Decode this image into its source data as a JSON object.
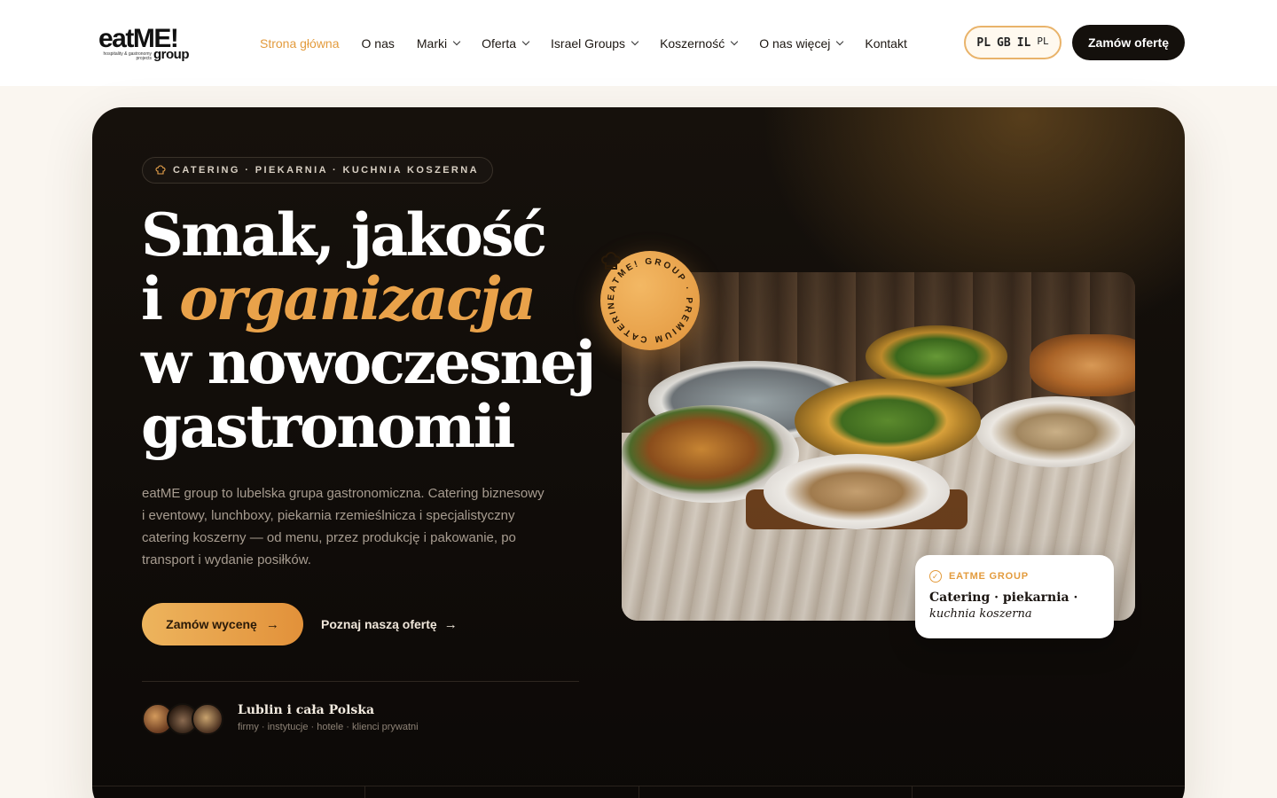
{
  "brand": {
    "name": "eatME!",
    "sub": "group",
    "tagline": "hospitality & gastronomy projects"
  },
  "nav": {
    "items": [
      {
        "label": "Strona główna",
        "active": true,
        "dropdown": false
      },
      {
        "label": "O nas",
        "active": false,
        "dropdown": false
      },
      {
        "label": "Marki",
        "active": false,
        "dropdown": true
      },
      {
        "label": "Oferta",
        "active": false,
        "dropdown": true
      },
      {
        "label": "Israel Groups",
        "active": false,
        "dropdown": true
      },
      {
        "label": "Koszerność",
        "active": false,
        "dropdown": true
      },
      {
        "label": "O nas więcej",
        "active": false,
        "dropdown": true
      },
      {
        "label": "Kontakt",
        "active": false,
        "dropdown": false
      }
    ],
    "languages": [
      "PL",
      "GB",
      "IL"
    ],
    "current_language": "PL",
    "cta": "Zamów ofertę"
  },
  "hero": {
    "eyebrow": "CATERING · PIEKARNIA · KUCHNIA KOSZERNA",
    "headline_1": "Smak, jakość",
    "headline_2a": "i ",
    "headline_2b": "organizacja",
    "headline_3": "w nowoczesnej",
    "headline_4": "gastronomii",
    "lead": "eatME group to lubelska grupa gastronomiczna. Catering biznesowy i eventowy, lunchboxy, piekarnia rzemieślnicza i specjalistyczny catering koszerny — od menu, przez produkcję i pakowanie, po transport i wydanie posiłków.",
    "primary_cta": "Zamów wycenę",
    "secondary_cta": "Poznaj naszą ofertę",
    "location_title": "Lublin i cała Polska",
    "location_sub": "firmy · instytucje · hotele · klienci prywatni"
  },
  "badge": {
    "ring_text": "EATME! GROUP · PREMIUM CATERIN"
  },
  "caption_card": {
    "kicker": "EATME GROUP",
    "line1": "Catering · piekarnia ·",
    "line2": "kuchnia koszerna"
  },
  "colors": {
    "accent": "#e39b3d",
    "dark": "#14100c",
    "page_bg": "#faf6f0"
  },
  "icons": {
    "chef_hat": "chef-hat-icon",
    "arrow": "arrow-right-icon",
    "check": "check-circle-icon",
    "chevron": "chevron-down-icon"
  }
}
